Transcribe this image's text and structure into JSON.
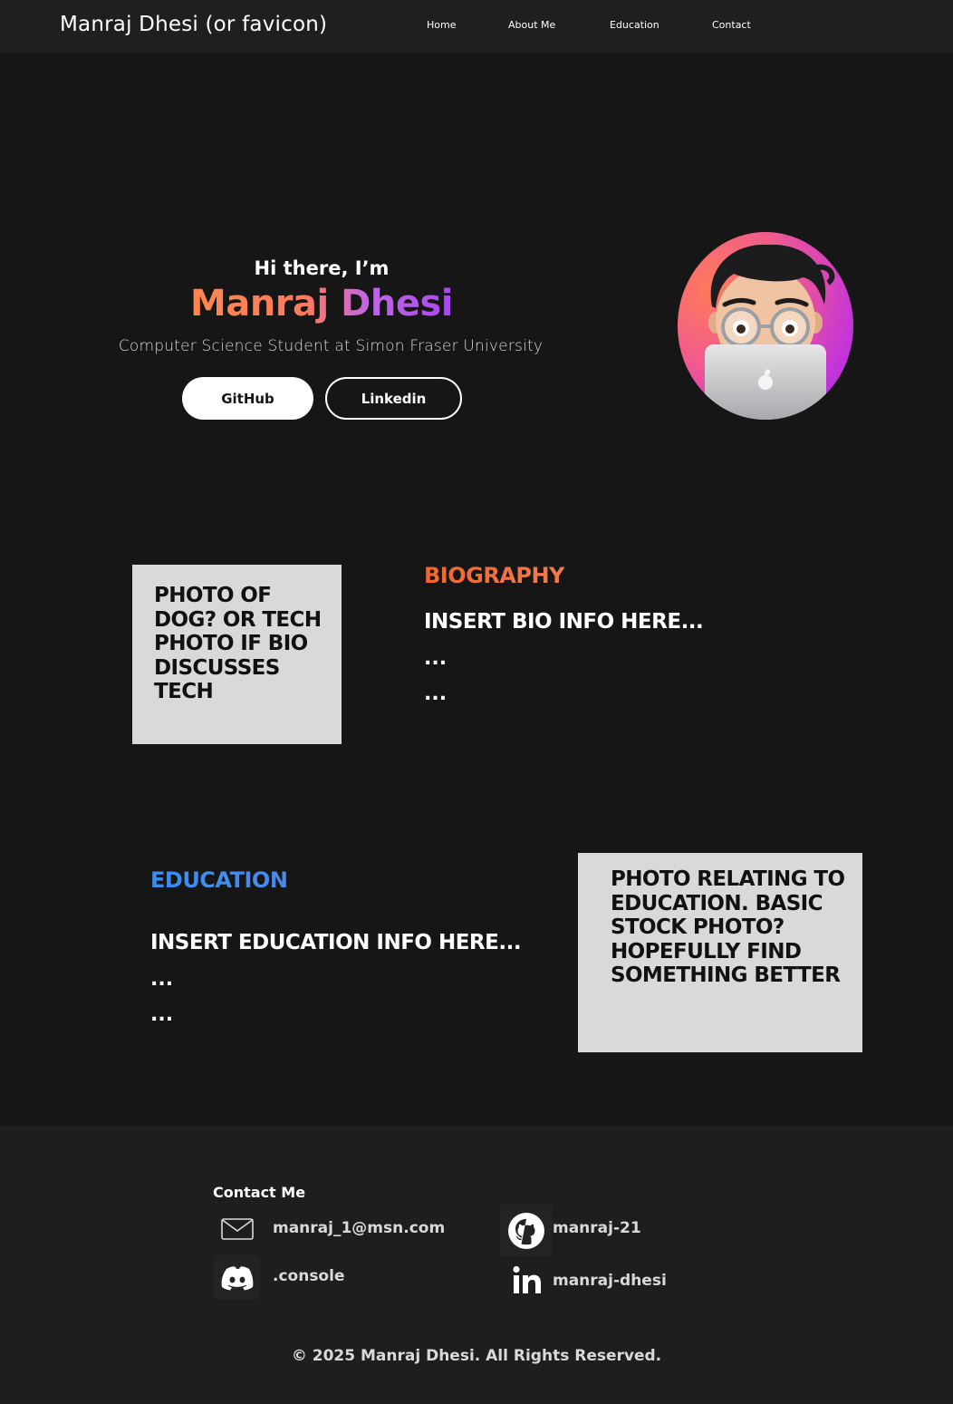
{
  "nav": {
    "brand": "Manraj Dhesi (or favicon)",
    "links": [
      {
        "label": "Home"
      },
      {
        "label": "About Me"
      },
      {
        "label": "Education"
      },
      {
        "label": "Contact"
      }
    ]
  },
  "hero": {
    "greeting": "Hi there, I’m",
    "name": "Manraj Dhesi",
    "subtitle": "Computer Science Student at Simon Fraser University",
    "github_label": "GitHub",
    "linkedin_label": "Linkedin"
  },
  "bio": {
    "photo_placeholder": "PHOTO OF DOG? OR TECH PHOTO IF BIO DISCUSSES TECH",
    "heading": "BIOGRAPHY",
    "text": "INSERT BIO INFO HERE...",
    "dots": [
      "...",
      "..."
    ]
  },
  "education": {
    "heading": "EDUCATION",
    "text": "INSERT EDUCATION INFO HERE...",
    "dots": [
      "...",
      "..."
    ],
    "photo_placeholder": "PHOTO RELATING TO EDUCATION. BASIC STOCK PHOTO? HOPEFULLY FIND SOMETHING BETTER"
  },
  "contact": {
    "title": "Contact Me",
    "email": "manraj_1@msn.com",
    "discord": ".console",
    "github": "manraj-21",
    "linkedin": "manraj-dhesi"
  },
  "footer": {
    "copyright": "© 2025 Manraj Dhesi. All Rights Reserved."
  },
  "colors": {
    "background": "#171616",
    "nav_background": "#1f1f1f",
    "bio_accent": "#f0672f",
    "education_accent": "#3a8df0",
    "placeholder_box": "#d9d9d9"
  }
}
